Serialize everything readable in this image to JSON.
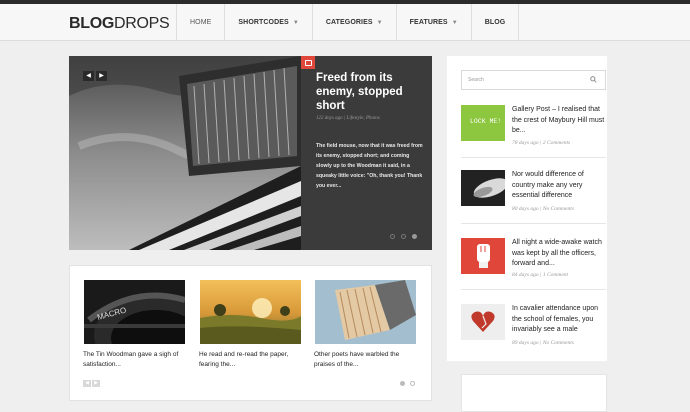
{
  "brand": {
    "logo_bold": "BLOG",
    "logo_light": "DROPS"
  },
  "nav": {
    "items": [
      {
        "label": "HOME",
        "has_dropdown": false,
        "active": true
      },
      {
        "label": "SHORTCODES",
        "has_dropdown": true
      },
      {
        "label": "CATEGORIES",
        "has_dropdown": true
      },
      {
        "label": "FEATURES",
        "has_dropdown": true
      },
      {
        "label": "BLOG",
        "has_dropdown": false
      }
    ]
  },
  "slider": {
    "title": "Freed from its enemy, stopped short",
    "meta": "122 days ago | Lifestyle, Photos",
    "excerpt": "The field mouse, now that it was freed from its enemy, stopped short; and coming slowly up to the Woodman it said, in a squeaky little voice: \"Oh, thank you! Thank you ever...",
    "prev_icon": "chevron-left-icon",
    "next_icon": "chevron-right-icon",
    "dots": 3,
    "active_dot": 2
  },
  "carousel": {
    "items": [
      {
        "caption": "The Tin Woodman gave a sigh of satisfaction..."
      },
      {
        "caption": "He read and re-read the paper, fearing the..."
      },
      {
        "caption": "Other poets have warbled the praises of the..."
      }
    ],
    "dots": 2,
    "active_dot": 0
  },
  "sidebar": {
    "search_placeholder": "Search",
    "posts": [
      {
        "title": "Gallery Post – I realised that the crest of Maybury Hill must be...",
        "meta": "78 days ago | 2 Comments",
        "thumb_text": "LOCK ME!"
      },
      {
        "title": "Nor would difference of country make any very essential difference",
        "meta": "80 days ago | No Comments"
      },
      {
        "title": "All night a wide-awake watch was kept by all the officers, forward and...",
        "meta": "84 days ago | 1 Comment"
      },
      {
        "title": "In cavalier attendance upon the school of females, you invariably see a male",
        "meta": "89 days ago | No Comments"
      }
    ]
  },
  "colors": {
    "accent": "#e0463a",
    "dark_panel": "#3b3b3b",
    "lime": "#8dc63f"
  }
}
